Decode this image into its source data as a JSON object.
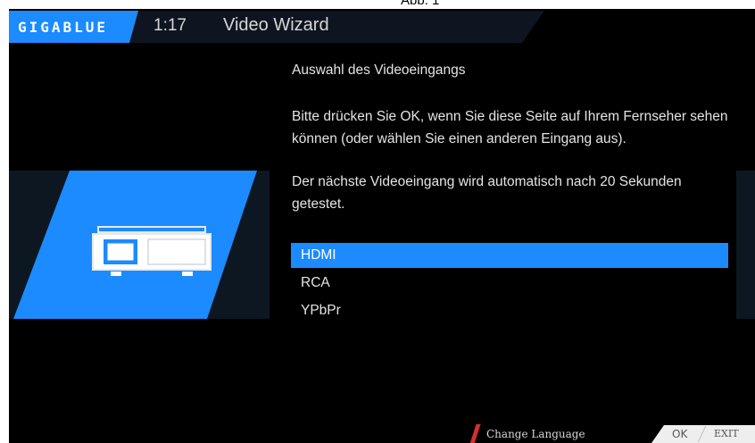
{
  "caption": "Abb. 1",
  "header": {
    "logo": "GIGABLUE",
    "time": "1:17",
    "title": "Video Wizard"
  },
  "content": {
    "heading": "Auswahl des Videoeingangs",
    "instruction": "Bitte drücken Sie OK, wenn Sie diese Seite auf Ihrem Fernseher sehen können (oder wählen Sie einen anderen Eingang aus).",
    "auto_test": "Der nächste Videoeingang wird automatisch nach 20 Sekunden getestet."
  },
  "options": [
    {
      "label": "HDMI",
      "selected": true
    },
    {
      "label": "RCA",
      "selected": false
    },
    {
      "label": "YPbPr",
      "selected": false
    }
  ],
  "footer": {
    "change_language": "Change Language",
    "ok": "OK",
    "exit": "EXIT"
  },
  "colors": {
    "accent": "#1b8bff",
    "red_key": "#d0322a",
    "background": "#000000"
  },
  "icons": {
    "device": "set-top-box-icon"
  }
}
